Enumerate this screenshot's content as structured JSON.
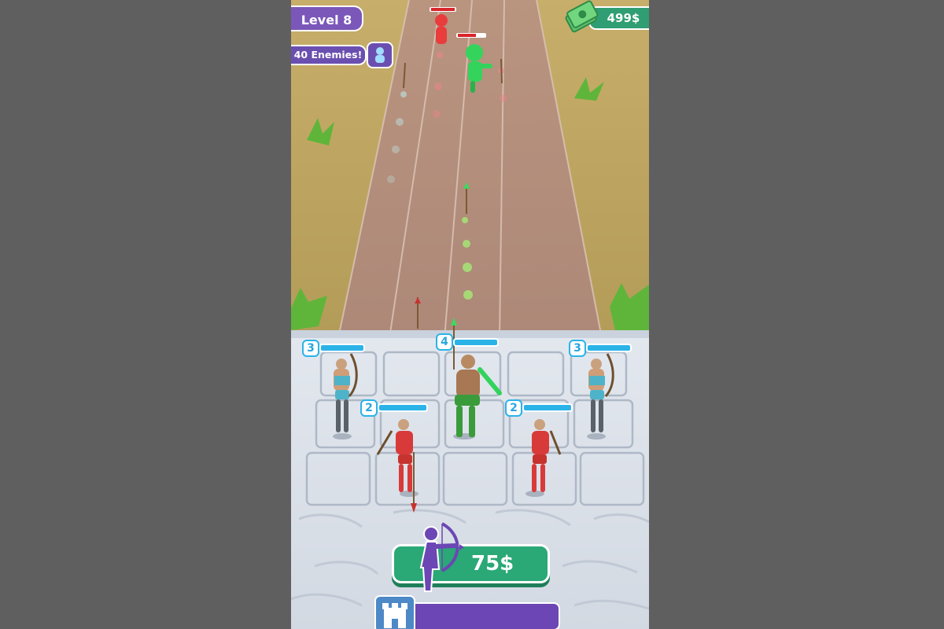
{
  "hud": {
    "level_label": "Level 8",
    "enemies_label": "40 Enemies!",
    "money_label": "499$"
  },
  "units": [
    {
      "level": "3",
      "team": "blue",
      "health_fraction": 1.0
    },
    {
      "level": "4",
      "team": "green",
      "health_fraction": 1.0
    },
    {
      "level": "3",
      "team": "blue",
      "health_fraction": 1.0
    },
    {
      "level": "2",
      "team": "red",
      "health_fraction": 1.0
    },
    {
      "level": "2",
      "team": "red",
      "health_fraction": 1.0
    }
  ],
  "enemies": [
    {
      "color": "red",
      "health_fraction": 1.0
    },
    {
      "color": "green",
      "health_fraction": 0.7
    }
  ],
  "buy_archer": {
    "price_label": "75$",
    "icon": "archer-icon"
  },
  "castle": {
    "icon": "castle-icon",
    "health_fraction": 1.0
  },
  "colors": {
    "purple_panel": "#6c46b4",
    "money_green": "#2aa876",
    "unit_bar_blue": "#2bb3e8",
    "enemy_bar_red": "#d9252b"
  }
}
